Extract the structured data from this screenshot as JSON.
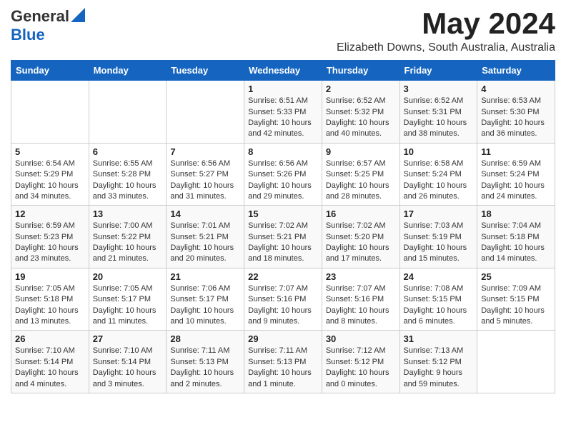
{
  "header": {
    "logo_general": "General",
    "logo_blue": "Blue",
    "title": "May 2024",
    "subtitle": "Elizabeth Downs, South Australia, Australia"
  },
  "days_of_week": [
    "Sunday",
    "Monday",
    "Tuesday",
    "Wednesday",
    "Thursday",
    "Friday",
    "Saturday"
  ],
  "weeks": [
    {
      "days": [
        {
          "number": "",
          "info": ""
        },
        {
          "number": "",
          "info": ""
        },
        {
          "number": "",
          "info": ""
        },
        {
          "number": "1",
          "info": "Sunrise: 6:51 AM\nSunset: 5:33 PM\nDaylight: 10 hours\nand 42 minutes."
        },
        {
          "number": "2",
          "info": "Sunrise: 6:52 AM\nSunset: 5:32 PM\nDaylight: 10 hours\nand 40 minutes."
        },
        {
          "number": "3",
          "info": "Sunrise: 6:52 AM\nSunset: 5:31 PM\nDaylight: 10 hours\nand 38 minutes."
        },
        {
          "number": "4",
          "info": "Sunrise: 6:53 AM\nSunset: 5:30 PM\nDaylight: 10 hours\nand 36 minutes."
        }
      ]
    },
    {
      "days": [
        {
          "number": "5",
          "info": "Sunrise: 6:54 AM\nSunset: 5:29 PM\nDaylight: 10 hours\nand 34 minutes."
        },
        {
          "number": "6",
          "info": "Sunrise: 6:55 AM\nSunset: 5:28 PM\nDaylight: 10 hours\nand 33 minutes."
        },
        {
          "number": "7",
          "info": "Sunrise: 6:56 AM\nSunset: 5:27 PM\nDaylight: 10 hours\nand 31 minutes."
        },
        {
          "number": "8",
          "info": "Sunrise: 6:56 AM\nSunset: 5:26 PM\nDaylight: 10 hours\nand 29 minutes."
        },
        {
          "number": "9",
          "info": "Sunrise: 6:57 AM\nSunset: 5:25 PM\nDaylight: 10 hours\nand 28 minutes."
        },
        {
          "number": "10",
          "info": "Sunrise: 6:58 AM\nSunset: 5:24 PM\nDaylight: 10 hours\nand 26 minutes."
        },
        {
          "number": "11",
          "info": "Sunrise: 6:59 AM\nSunset: 5:24 PM\nDaylight: 10 hours\nand 24 minutes."
        }
      ]
    },
    {
      "days": [
        {
          "number": "12",
          "info": "Sunrise: 6:59 AM\nSunset: 5:23 PM\nDaylight: 10 hours\nand 23 minutes."
        },
        {
          "number": "13",
          "info": "Sunrise: 7:00 AM\nSunset: 5:22 PM\nDaylight: 10 hours\nand 21 minutes."
        },
        {
          "number": "14",
          "info": "Sunrise: 7:01 AM\nSunset: 5:21 PM\nDaylight: 10 hours\nand 20 minutes."
        },
        {
          "number": "15",
          "info": "Sunrise: 7:02 AM\nSunset: 5:21 PM\nDaylight: 10 hours\nand 18 minutes."
        },
        {
          "number": "16",
          "info": "Sunrise: 7:02 AM\nSunset: 5:20 PM\nDaylight: 10 hours\nand 17 minutes."
        },
        {
          "number": "17",
          "info": "Sunrise: 7:03 AM\nSunset: 5:19 PM\nDaylight: 10 hours\nand 15 minutes."
        },
        {
          "number": "18",
          "info": "Sunrise: 7:04 AM\nSunset: 5:18 PM\nDaylight: 10 hours\nand 14 minutes."
        }
      ]
    },
    {
      "days": [
        {
          "number": "19",
          "info": "Sunrise: 7:05 AM\nSunset: 5:18 PM\nDaylight: 10 hours\nand 13 minutes."
        },
        {
          "number": "20",
          "info": "Sunrise: 7:05 AM\nSunset: 5:17 PM\nDaylight: 10 hours\nand 11 minutes."
        },
        {
          "number": "21",
          "info": "Sunrise: 7:06 AM\nSunset: 5:17 PM\nDaylight: 10 hours\nand 10 minutes."
        },
        {
          "number": "22",
          "info": "Sunrise: 7:07 AM\nSunset: 5:16 PM\nDaylight: 10 hours\nand 9 minutes."
        },
        {
          "number": "23",
          "info": "Sunrise: 7:07 AM\nSunset: 5:16 PM\nDaylight: 10 hours\nand 8 minutes."
        },
        {
          "number": "24",
          "info": "Sunrise: 7:08 AM\nSunset: 5:15 PM\nDaylight: 10 hours\nand 6 minutes."
        },
        {
          "number": "25",
          "info": "Sunrise: 7:09 AM\nSunset: 5:15 PM\nDaylight: 10 hours\nand 5 minutes."
        }
      ]
    },
    {
      "days": [
        {
          "number": "26",
          "info": "Sunrise: 7:10 AM\nSunset: 5:14 PM\nDaylight: 10 hours\nand 4 minutes."
        },
        {
          "number": "27",
          "info": "Sunrise: 7:10 AM\nSunset: 5:14 PM\nDaylight: 10 hours\nand 3 minutes."
        },
        {
          "number": "28",
          "info": "Sunrise: 7:11 AM\nSunset: 5:13 PM\nDaylight: 10 hours\nand 2 minutes."
        },
        {
          "number": "29",
          "info": "Sunrise: 7:11 AM\nSunset: 5:13 PM\nDaylight: 10 hours\nand 1 minute."
        },
        {
          "number": "30",
          "info": "Sunrise: 7:12 AM\nSunset: 5:12 PM\nDaylight: 10 hours\nand 0 minutes."
        },
        {
          "number": "31",
          "info": "Sunrise: 7:13 AM\nSunset: 5:12 PM\nDaylight: 9 hours\nand 59 minutes."
        },
        {
          "number": "",
          "info": ""
        }
      ]
    }
  ]
}
